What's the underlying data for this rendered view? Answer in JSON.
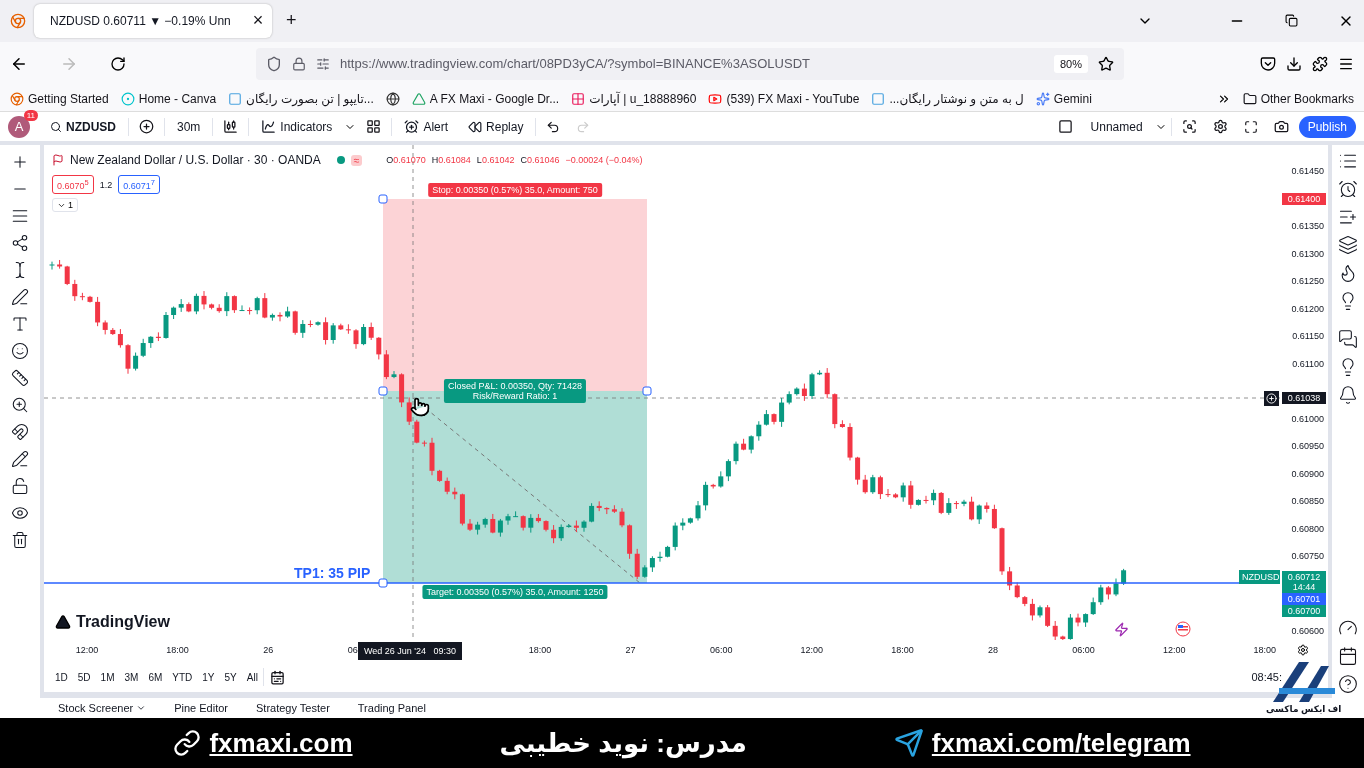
{
  "browser": {
    "tab": {
      "title": "NZDUSD 0.60711 ▼ −0.19% Unn",
      "close": "×"
    },
    "new_tab": "+",
    "url": "https://www.tradingview.com/chart/08PD3yCA/?symbol=BINANCE%3ASOLUSDT",
    "zoom": "80%",
    "bookmarks": [
      {
        "label": "Getting Started",
        "kind": "firefox"
      },
      {
        "label": "Home - Canva",
        "kind": "canva"
      },
      {
        "label": "تایپو | تن بصورت رایگان...",
        "kind": "typo"
      },
      {
        "kind": "globe"
      },
      {
        "label": "A FX Maxi - Google Dr...",
        "kind": "drive"
      },
      {
        "label": "آپارات | u_18888960",
        "kind": "aparat"
      },
      {
        "label": "(539) FX Maxi - YouTube",
        "kind": "youtube"
      },
      {
        "label": "...ل به متن و نوشتار رایگان",
        "kind": "typo"
      },
      {
        "label": "Gemini",
        "kind": "gemini"
      }
    ],
    "other_bookmarks": "Other Bookmarks"
  },
  "toolbar": {
    "avatar": "A",
    "notifications": "11",
    "symbol": "NZDUSD",
    "interval": "30m",
    "indicators": "Indicators",
    "alert": "Alert",
    "replay": "Replay",
    "layout_name": "Unnamed",
    "layout_checked": false,
    "publish": "Publish"
  },
  "legend": {
    "title": "New Zealand Dollar / U.S. Dollar · 30 · OANDA",
    "ohlc": [
      {
        "label": "O",
        "value": "0.61070"
      },
      {
        "label": "H",
        "value": "0.61084"
      },
      {
        "label": "L",
        "value": "0.61042"
      },
      {
        "label": "C",
        "value": "0.61046"
      }
    ],
    "change": "−0.00024 (−0.04%)",
    "wave": "≈",
    "sell": "0.6070$^{5}$",
    "spread": "1.2",
    "buy": "0.6071$^{7}$",
    "indicators_count": "1"
  },
  "position": {
    "stop": "Stop: 0.00350 (0.57%) 35.0, Amount: 750",
    "closed": "Closed P&L: 0.00350, Qty: 71428",
    "ratio": "Risk/Reward Ratio: 1",
    "target": "Target: 0.00350 (0.57%) 35.0, Amount: 1250",
    "tp_label": "TP1: 35 PIP"
  },
  "watermark": "TradingView",
  "price_axis": [
    "0.61450",
    "0.61350",
    "0.61300",
    "0.61250",
    "0.61200",
    "0.61150",
    "0.61100",
    "0.61000",
    "0.60950",
    "0.60900",
    "0.60850",
    "0.60800",
    "0.60750",
    "0.60600"
  ],
  "price_badges": [
    {
      "text": "0.61400",
      "kind": "alert"
    },
    {
      "text": "0.61038",
      "kind": "crosshair"
    },
    {
      "text": "0.60712",
      "sub": "14:44",
      "kind": "last"
    },
    {
      "text": "0.60701",
      "kind": "buy"
    },
    {
      "text": "0.60700",
      "kind": "last"
    }
  ],
  "symbol_tag": "NZDUSD",
  "time_axis": [
    "12:00",
    "18:00",
    "26",
    "06",
    "18:00",
    "27",
    "06:00",
    "12:00",
    "18:00",
    "28",
    "06:00",
    "12:00",
    "18:00"
  ],
  "crosshair_time": "Wed 26 Jun '24   09:30",
  "ranges": [
    "1D",
    "5D",
    "1M",
    "3M",
    "6M",
    "YTD",
    "1Y",
    "5Y",
    "All"
  ],
  "clock": "08:45:",
  "bottom_tabs": [
    {
      "label": "Stock Screener",
      "menu": true
    },
    {
      "label": "Pine Editor",
      "menu": false
    },
    {
      "label": "Strategy Tester",
      "menu": false
    },
    {
      "label": "Trading Panel",
      "menu": false
    }
  ],
  "logo_caption": "اف ایکس ماکسی",
  "footer": {
    "site": "fxmaxi.com",
    "teacher": "مدرس: نوید خطیبی",
    "telegram": "fxmaxi.com/telegram"
  }
}
